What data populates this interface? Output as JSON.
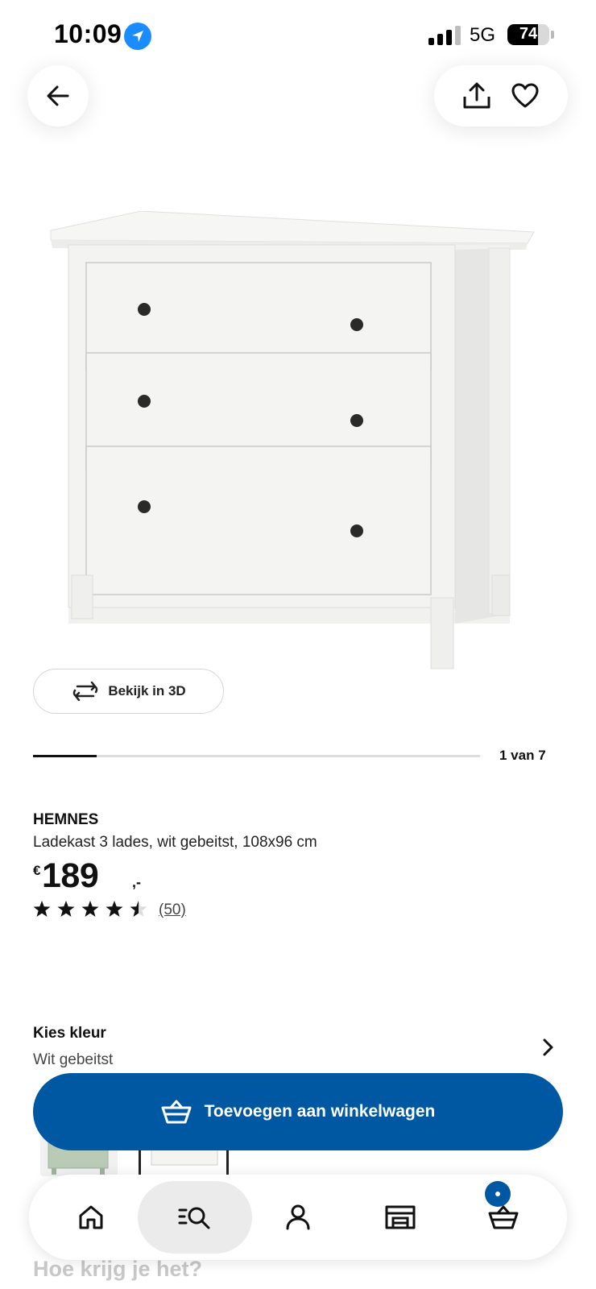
{
  "status_bar": {
    "time": "10:09",
    "network": "5G",
    "battery": "74",
    "battery_level": 0.74,
    "icons": [
      "location-arrow-icon",
      "signal-icon",
      "battery-icon"
    ]
  },
  "header": {
    "icons": [
      "arrow-left-icon",
      "share-icon",
      "heart-icon"
    ]
  },
  "gallery": {
    "view_3d_label": "Bekijk in 3D",
    "counter": "1 van 7",
    "current": 1,
    "total": 7
  },
  "product": {
    "name": "HEMNES",
    "description": "Ladekast 3 lades, wit gebeitst, 108x96 cm",
    "price_currency": "€",
    "price_amount": "189",
    "price_decimals": ",-",
    "rating": 4.5,
    "rating_max": 5,
    "rating_count": "(50)"
  },
  "color_selector": {
    "title": "Kies kleur",
    "value": "Wit gebeitst"
  },
  "cta": {
    "add_to_cart_label": "Toevoegen aan winkelwagen"
  },
  "delivery": {
    "heading": "Hoe krijg je het?"
  },
  "bottom_nav": {
    "items": [
      "home-icon",
      "search-icon",
      "profile-icon",
      "store-icon",
      "cart-icon"
    ],
    "active": "search-icon"
  },
  "colors": {
    "brand_blue": "#0058a3",
    "location_blue": "#1a8cff",
    "nav_active_bg": "#ebebeb"
  }
}
